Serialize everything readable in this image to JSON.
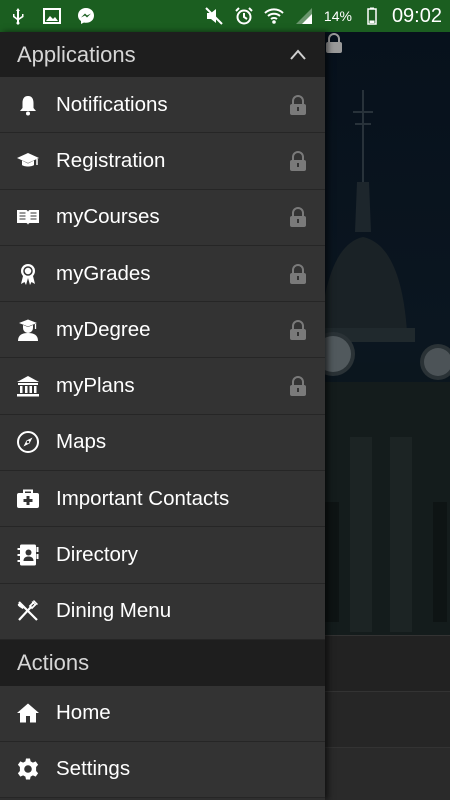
{
  "status_bar": {
    "left_icons": [
      "usb-icon",
      "image-icon",
      "messenger-icon"
    ],
    "right_icons": [
      "mute-icon",
      "alarm-icon",
      "wifi-icon",
      "signal-icon",
      "battery-icon"
    ],
    "battery": "14%",
    "time": "09:02",
    "color": "#1b5e20"
  },
  "drawer": {
    "applications_header": "Applications",
    "applications": [
      {
        "label": "Notifications",
        "icon": "bell-icon",
        "locked": true
      },
      {
        "label": "Registration",
        "icon": "graduation-cap-icon",
        "locked": true
      },
      {
        "label": "myCourses",
        "icon": "book-icon",
        "locked": true
      },
      {
        "label": "myGrades",
        "icon": "award-ribbon-icon",
        "locked": true
      },
      {
        "label": "myDegree",
        "icon": "graduate-icon",
        "locked": true
      },
      {
        "label": "myPlans",
        "icon": "institution-icon",
        "locked": true
      },
      {
        "label": "Maps",
        "icon": "compass-icon",
        "locked": false
      },
      {
        "label": "Important Contacts",
        "icon": "first-aid-icon",
        "locked": false
      },
      {
        "label": "Directory",
        "icon": "address-book-icon",
        "locked": false
      },
      {
        "label": "Dining Menu",
        "icon": "utensils-icon",
        "locked": false
      }
    ],
    "actions_header": "Actions",
    "actions": [
      {
        "label": "Home",
        "icon": "home-icon"
      },
      {
        "label": "Settings",
        "icon": "gear-icon"
      }
    ]
  }
}
